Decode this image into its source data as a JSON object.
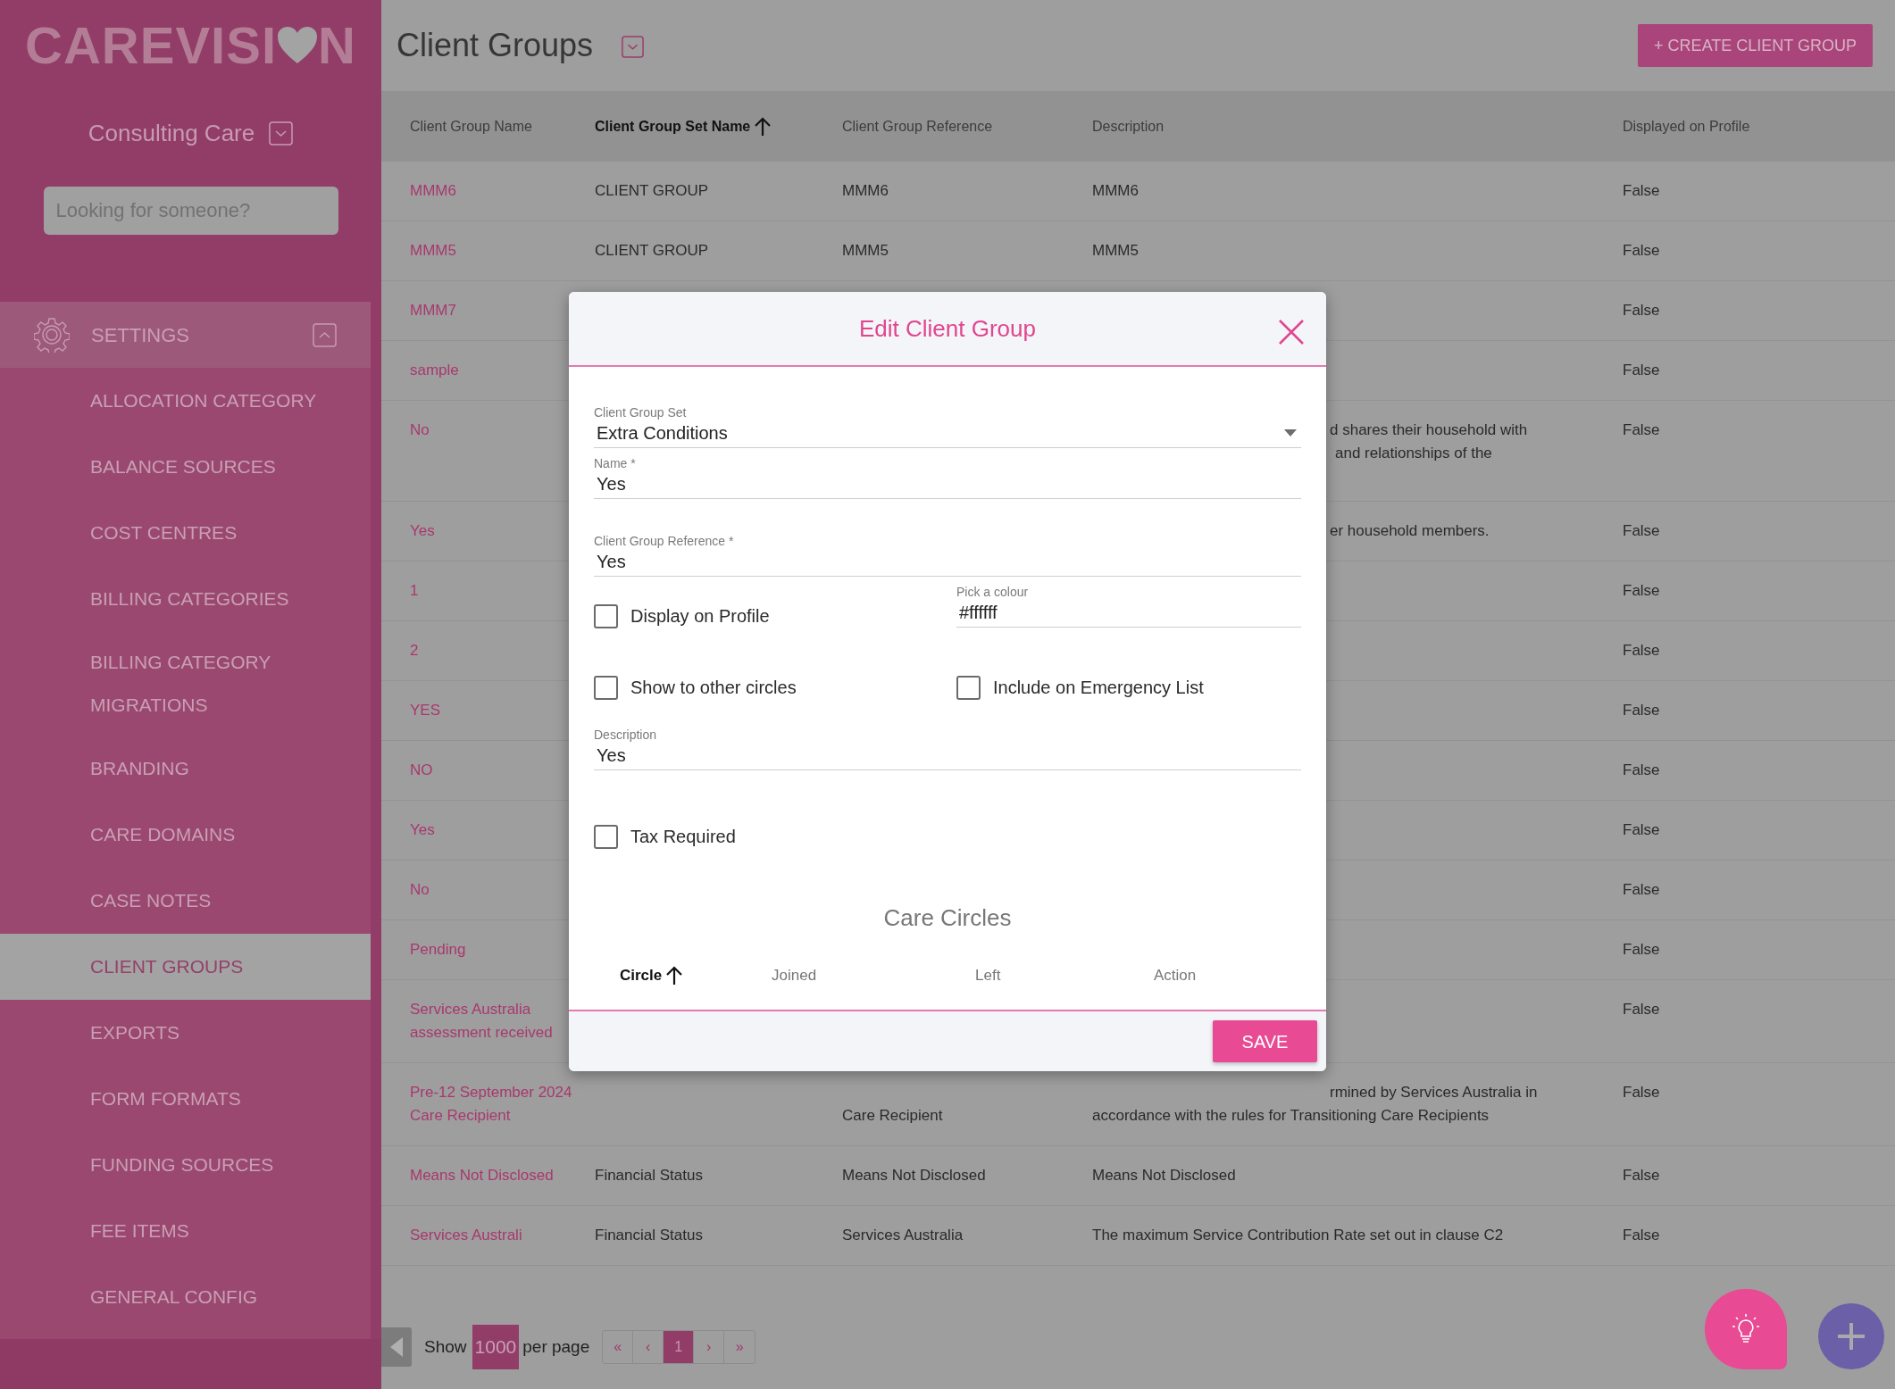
{
  "sidebar": {
    "logo": {
      "before_heart": "CAREVISI",
      "after_heart": "N"
    },
    "organization": "Consulting Care",
    "search": {
      "placeholder": "Looking for someone?"
    },
    "section": {
      "label": "SETTINGS",
      "expanded": true
    },
    "items": [
      {
        "label": "ALLOCATION CATEGORY",
        "selected": false
      },
      {
        "label": "BALANCE SOURCES",
        "selected": false
      },
      {
        "label": "COST CENTRES",
        "selected": false
      },
      {
        "label": "BILLING CATEGORIES",
        "selected": false
      },
      {
        "label": "BILLING CATEGORY MIGRATIONS",
        "selected": false
      },
      {
        "label": "BRANDING",
        "selected": false
      },
      {
        "label": "CARE DOMAINS",
        "selected": false
      },
      {
        "label": "CASE NOTES",
        "selected": false
      },
      {
        "label": "CLIENT GROUPS",
        "selected": true
      },
      {
        "label": "EXPORTS",
        "selected": false
      },
      {
        "label": "FORM FORMATS",
        "selected": false
      },
      {
        "label": "FUNDING SOURCES",
        "selected": false
      },
      {
        "label": "FEE ITEMS",
        "selected": false
      },
      {
        "label": "GENERAL CONFIG",
        "selected": false
      }
    ]
  },
  "page": {
    "title": "Client Groups",
    "create_button": "+ CREATE CLIENT GROUP"
  },
  "table": {
    "columns": [
      {
        "label": "Client Group Name",
        "sorted": false
      },
      {
        "label": "Client Group Set Name",
        "sorted": true
      },
      {
        "label": "Client Group Reference",
        "sorted": false
      },
      {
        "label": "Description",
        "sorted": false
      },
      {
        "label": "Displayed on Profile",
        "sorted": false
      }
    ],
    "rows": [
      {
        "name": "MMM6",
        "set_name": "CLIENT GROUP",
        "reference": "MMM6",
        "description": [
          "MMM6"
        ],
        "displayed": "False"
      },
      {
        "name": "MMM5",
        "set_name": "CLIENT GROUP",
        "reference": "MMM5",
        "description": [
          "MMM5"
        ],
        "displayed": "False"
      },
      {
        "name": "MMM7",
        "displayed": "False"
      },
      {
        "name": "sample",
        "displayed": "False"
      },
      {
        "name": "No",
        "description": [
          "d shares their household with",
          "and relationships of the"
        ],
        "displayed": "False"
      },
      {
        "name": "Yes",
        "description": [
          "er household members."
        ],
        "displayed": "False"
      },
      {
        "name": "1",
        "displayed": "False"
      },
      {
        "name": "2",
        "displayed": "False"
      },
      {
        "name": "YES",
        "displayed": "False"
      },
      {
        "name": "NO",
        "displayed": "False"
      },
      {
        "name": "Yes",
        "displayed": "False"
      },
      {
        "name": "No",
        "displayed": "False"
      },
      {
        "name": "Pending",
        "displayed": "False"
      },
      {
        "name": "Services Australia assessment received",
        "displayed": "False"
      },
      {
        "name": "Pre-12 September 2024 Care Recipient",
        "reference": "Care Recipient",
        "description": [
          "rmined by Services Australia in",
          "accordance with the rules for Transitioning Care Recipients"
        ],
        "displayed": "False"
      },
      {
        "name": "Means Not Disclosed",
        "set_name": "Financial Status",
        "reference": "Means Not Disclosed",
        "description": [
          "Means Not Disclosed"
        ],
        "displayed": "False"
      },
      {
        "name": "Services Australi",
        "set_name": "Financial Status",
        "reference": "Services Australia",
        "description": [
          "The maximum Service Contribution Rate set out in clause C2"
        ],
        "displayed": "False"
      }
    ]
  },
  "pagination": {
    "show": "Show",
    "per_page_value": "1000",
    "per_page": "per page",
    "pages": [
      {
        "label": "«",
        "selected": false
      },
      {
        "label": "‹",
        "selected": false
      },
      {
        "label": "1",
        "selected": true
      },
      {
        "label": "›",
        "selected": false
      },
      {
        "label": "»",
        "selected": false
      }
    ]
  },
  "modal": {
    "title": "Edit Client Group",
    "rows": [
      [
        {
          "kind": "select",
          "label": "Client Group Set",
          "value": "Extra Conditions"
        }
      ],
      [
        {
          "kind": "text",
          "label": "Name *",
          "value": "Yes"
        }
      ],
      [
        {
          "kind": "text",
          "label": "Client Group Reference *",
          "value": "Yes"
        }
      ],
      [
        {
          "kind": "checkbox",
          "label": "Display on Profile",
          "checked": false
        },
        {
          "kind": "text",
          "label": "Pick a colour",
          "value": "#ffffff"
        }
      ],
      [
        {
          "kind": "checkbox",
          "label": "Show to other circles",
          "checked": false
        },
        {
          "kind": "checkbox",
          "label": "Include on Emergency List",
          "checked": false
        }
      ],
      [
        {
          "kind": "text",
          "label": "Description",
          "value": "Yes"
        }
      ],
      [
        {
          "kind": "checkbox",
          "label": "Tax Required",
          "checked": false
        }
      ]
    ],
    "care_circles": {
      "title": "Care Circles",
      "columns": [
        {
          "label": "Circle",
          "sorted": true
        },
        {
          "label": "Joined",
          "sorted": false
        },
        {
          "label": "Left",
          "sorted": false
        },
        {
          "label": "Action",
          "sorted": false
        }
      ]
    },
    "save_button": "SAVE"
  }
}
